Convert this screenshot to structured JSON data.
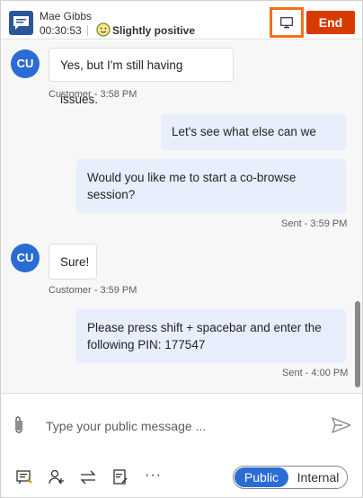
{
  "header": {
    "customer_name": "Mae Gibbs",
    "timer": "00:30:53",
    "sentiment": "Slightly positive",
    "end_label": "End"
  },
  "messages": [
    {
      "from": "customer",
      "avatar": "CU",
      "text": "Yes, but I'm still having issues.",
      "meta": "Customer - 3:58 PM"
    },
    {
      "from": "agent",
      "text": "Let's see what else can we do.",
      "meta": ""
    },
    {
      "from": "agent",
      "text": "Would you like me to start a co-browse session?",
      "meta": "Sent - 3:59 PM"
    },
    {
      "from": "customer",
      "avatar": "CU",
      "text": "Sure!",
      "meta": "Customer - 3:59 PM"
    },
    {
      "from": "agent",
      "text": "Please press shift + spacebar and enter the following PIN: 177547",
      "meta": "Sent - 4:00 PM"
    }
  ],
  "composer": {
    "placeholder": "Type your public message ...",
    "more_label": "···",
    "toggle": {
      "public": "Public",
      "internal": "Internal",
      "selected": "Public"
    }
  },
  "icons": {
    "chat": "chat-icon",
    "sentiment": "smiley-icon",
    "screen_share": "monitor-icon",
    "attach": "paperclip-icon",
    "send": "send-icon",
    "quick_replies": "quick-reply-icon",
    "consult": "add-person-icon",
    "transfer": "transfer-icon",
    "notes": "note-icon"
  },
  "colors": {
    "end_button": "#d83b01",
    "highlight_border": "#f2711c",
    "avatar": "#2b6cd4",
    "agent_bubble": "#e8eefc",
    "toggle_selected": "#2b6cd4"
  }
}
